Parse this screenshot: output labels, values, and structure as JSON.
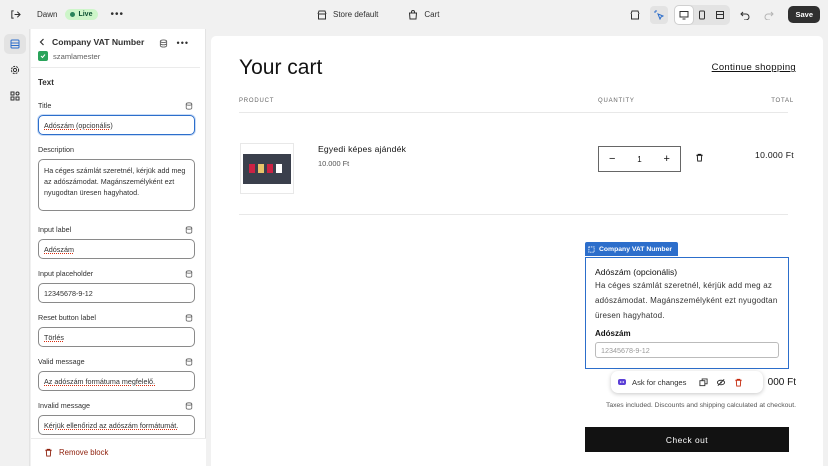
{
  "topbar": {
    "theme_name": "Dawn",
    "status_badge": "Live",
    "store_link": "Store default",
    "cart_link": "Cart",
    "save_label": "Save"
  },
  "panel": {
    "title": "Company VAT Number",
    "app_name": "szamlamester",
    "section": "Text",
    "fields": [
      {
        "label": "Title",
        "value": "Adószám (opcionális)"
      },
      {
        "label": "Description",
        "value": "Ha céges számlát szeretnél, kérjük add meg az adószámodat. Magánszemélyként ezt nyugodtan üresen hagyhatod."
      },
      {
        "label": "Input label",
        "value": "Adószám"
      },
      {
        "label": "Input placeholder",
        "value": "12345678-9-12"
      },
      {
        "label": "Reset button label",
        "value": "Törlés"
      },
      {
        "label": "Valid message",
        "value": "Az adószám formátuma megfelelő."
      },
      {
        "label": "Invalid message",
        "value": "Kérjük ellenőrizd az adószám formátumát."
      }
    ],
    "remove_label": "Remove block"
  },
  "preview": {
    "cart_title": "Your cart",
    "continue_label": "Continue shopping",
    "headers": {
      "product": "PRODUCT",
      "quantity": "QUANTITY",
      "total": "TOTAL"
    },
    "item": {
      "name": "Egyedi képes ajándék",
      "price": "10.000 Ft",
      "quantity": "1",
      "total": "10.000 Ft"
    },
    "block_tag": "Company VAT Number",
    "vat": {
      "title": "Adószám (opcionális)",
      "description": "Ha céges számlát szeretnél, kérjük add meg az adószámodat. Magánszemélyként ezt nyugodtan üresen hagyhatod.",
      "label": "Adószám",
      "placeholder": "12345678-9-12"
    },
    "subtotal_tail": "000 Ft",
    "ask_label": "Ask for changes",
    "taxes_note": "Taxes included. Discounts and shipping calculated at checkout.",
    "checkout_label": "Check out"
  },
  "colors": {
    "accent": "#2c6ecb",
    "live_bg": "#cdf5c9",
    "checkout_bg": "#121212"
  }
}
